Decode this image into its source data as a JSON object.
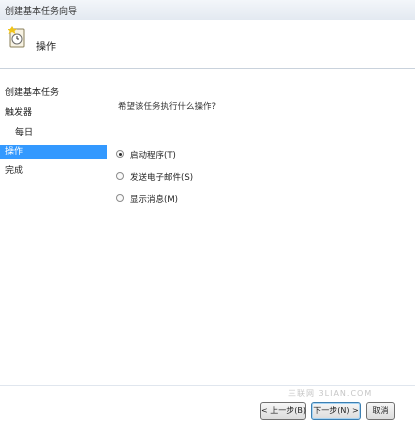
{
  "window": {
    "title": "创建基本任务向导"
  },
  "header": {
    "heading": "操作"
  },
  "nav": {
    "items": [
      {
        "label": "创建基本任务"
      },
      {
        "label": "触发器"
      },
      {
        "label": "每日"
      },
      {
        "label": "操作"
      },
      {
        "label": "完成"
      }
    ]
  },
  "content": {
    "question": "希望该任务执行什么操作?",
    "options": [
      {
        "label": "启动程序(T)",
        "checked": true
      },
      {
        "label": "发送电子邮件(S)",
        "checked": false
      },
      {
        "label": "显示消息(M)",
        "checked": false
      }
    ]
  },
  "watermark": "三联网 3LIAN.COM",
  "buttons": {
    "back": "< 上一步(B)",
    "next": "下一步(N) >",
    "cancel": "取消"
  },
  "colors": {
    "selection": "#3399ff",
    "header_border": "#c9d2dc"
  }
}
